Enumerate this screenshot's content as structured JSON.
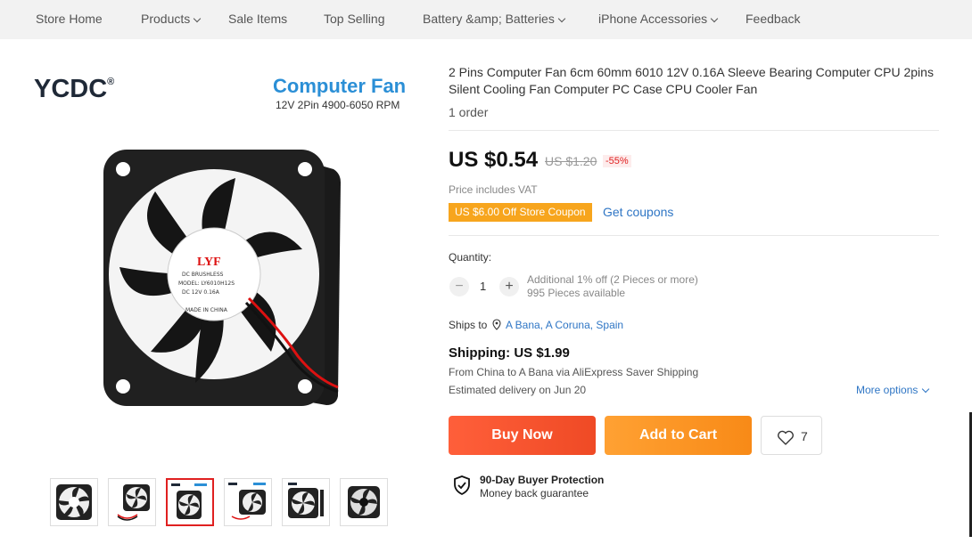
{
  "nav": {
    "items": [
      {
        "label": "Store Home",
        "dropdown": false
      },
      {
        "label": "Products",
        "dropdown": true
      },
      {
        "label": "Sale Items",
        "dropdown": false
      },
      {
        "label": "Top Selling",
        "dropdown": false
      },
      {
        "label": "Battery &amp; Batteries",
        "dropdown": true
      },
      {
        "label": "iPhone Accessories",
        "dropdown": true
      },
      {
        "label": "Feedback",
        "dropdown": false
      }
    ]
  },
  "gallery": {
    "brand": "YCDC",
    "brand_mark": "®",
    "banner_title": "Computer Fan",
    "banner_subtitle": "12V 2Pin 4900-6050 RPM",
    "fan_label": {
      "brand": "LYF",
      "line1": "DC BRUSHLESS",
      "line2": "MODEL: LY6010H12S",
      "line3": "DC  12V  0.16A",
      "line4": "MADE IN CHINA"
    },
    "thumbnail_count": 6,
    "active_thumbnail": 2
  },
  "product": {
    "title": "2 Pins Computer Fan 6cm 60mm 6010 12V 0.16A Sleeve Bearing Computer CPU 2pins Silent Cooling Fan Computer PC Case CPU Cooler Fan",
    "orders": "1 order",
    "price": "US $0.54",
    "old_price": "US $1.20",
    "discount": "-55%",
    "vat_note": "Price includes VAT",
    "coupon": "US $6.00 Off Store Coupon",
    "get_coupons": "Get coupons"
  },
  "quantity": {
    "label": "Quantity:",
    "value": "1",
    "minus": "−",
    "plus": "+",
    "note_line1": "Additional 1% off (2 Pieces or more)",
    "note_line2": "995 Pieces available"
  },
  "shipping": {
    "ships_to_label": "Ships to",
    "destination": "A Bana, A Coruna, Spain",
    "cost": "Shipping: US $1.99",
    "via": "From China to A Bana via AliExpress Saver Shipping",
    "delivery": "Estimated delivery on Jun 20",
    "more_options": "More options"
  },
  "actions": {
    "buy_now": "Buy Now",
    "add_to_cart": "Add to Cart",
    "wishlist_count": "7"
  },
  "protection": {
    "title": "90-Day Buyer Protection",
    "subtitle": "Money back guarantee"
  },
  "colors": {
    "buy_now": "#f0502a",
    "add_to_cart": "#fa951f",
    "link": "#2f76c5",
    "coupon": "#f7a51d",
    "discount": "#e02020"
  }
}
